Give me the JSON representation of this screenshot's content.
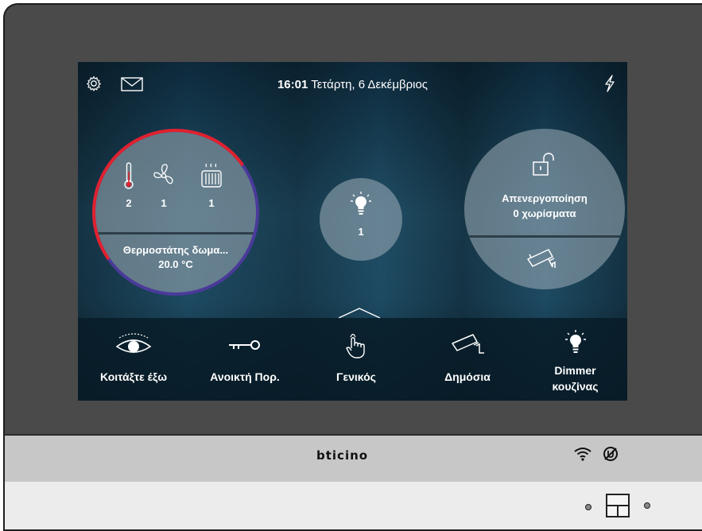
{
  "header": {
    "time": "16:01",
    "date": "Τετάρτη, 6 Δεκέμβριος"
  },
  "thermostat": {
    "counts": [
      "2",
      "1",
      "1"
    ],
    "name": "Θερμοστάτης δωμα...",
    "temperature": "20.0 °C",
    "ring_colors": [
      "#e0212e",
      "#4a3a9a"
    ]
  },
  "lights": {
    "count": "1"
  },
  "alarm": {
    "line1": "Απενεργοποίηση",
    "line2": "0 χωρίσματα"
  },
  "bottom_bar": {
    "items": [
      {
        "label": "Κοιτάξτε έξω",
        "icon": "eye-icon"
      },
      {
        "label": "Ανοικτή Πορ.",
        "icon": "key-icon"
      },
      {
        "label": "Γενικός",
        "icon": "hand-pointer-icon"
      },
      {
        "label": "Δημόσια",
        "icon": "camera-icon"
      },
      {
        "label_line1": "Dimmer",
        "label_line2": "κουζίνας",
        "icon": "bulb-icon"
      }
    ]
  },
  "device": {
    "brand": "bticino"
  },
  "icons": [
    "gear-icon",
    "mail-icon",
    "bolt-icon",
    "thermometer-icon",
    "fan-icon",
    "radiator-icon",
    "bulb-icon",
    "unlock-icon",
    "camera-icon",
    "chevron-up-icon",
    "wifi-icon",
    "mute-icon"
  ]
}
